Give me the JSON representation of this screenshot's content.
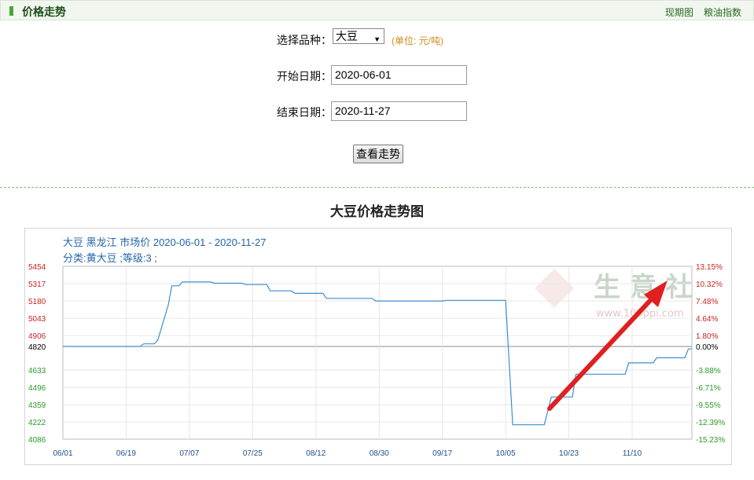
{
  "topbar": {
    "title": "价格走势",
    "links": [
      "现期图",
      "粮油指数"
    ]
  },
  "form": {
    "variety_label": "选择品种：",
    "variety_value": "大豆",
    "unit": "(单位: 元/吨)",
    "start_label": "开始日期：",
    "start_value": "2020-06-01",
    "end_label": "结束日期：",
    "end_value": "2020-11-27",
    "submit_label": "查看走势"
  },
  "chart_heading": "大豆价格走势图",
  "chart_subtitle_1": "大豆 黑龙江 市场价 2020-06-01 - 2020-11-27",
  "chart_subtitle_2": "分类:黄大豆 ;等级:3 ;",
  "watermark": "生 意 社",
  "watermark_url": "www.100ppi.com",
  "colors": {
    "line": "#3a8fd1",
    "up": "#cc2222",
    "down": "#2a9a2a",
    "arrow": "#e02020"
  },
  "chart_data": {
    "type": "line",
    "title": "大豆 黑龙江 市场价 2020-06-01 - 2020-11-27",
    "base_value": 4820,
    "ylim": [
      4086,
      5454
    ],
    "y_ticks_left": [
      5454,
      5317,
      5180,
      5043,
      4906,
      4820,
      4633,
      4496,
      4359,
      4222,
      4086
    ],
    "y_ticks_right": [
      "13.15%",
      "10.32%",
      "7.48%",
      "4.64%",
      "1.80%",
      "0.00%",
      "-3.88%",
      "-6.71%",
      "-9.55%",
      "-12.39%",
      "-15.23%"
    ],
    "x_ticks": [
      "06/01",
      "06/19",
      "07/07",
      "07/25",
      "08/12",
      "08/30",
      "09/17",
      "10/05",
      "10/23",
      "11/10"
    ],
    "x_start": "2020-06-01",
    "x_end": "2020-11-27",
    "grid": true,
    "series": [
      {
        "points": [
          [
            "2020-06-01",
            4820
          ],
          [
            "2020-06-23",
            4820
          ],
          [
            "2020-06-24",
            4840
          ],
          [
            "2020-06-27",
            4840
          ],
          [
            "2020-06-28",
            4870
          ],
          [
            "2020-07-01",
            5150
          ],
          [
            "2020-07-02",
            5300
          ],
          [
            "2020-07-04",
            5300
          ],
          [
            "2020-07-05",
            5330
          ],
          [
            "2020-07-13",
            5330
          ],
          [
            "2020-07-14",
            5320
          ],
          [
            "2020-07-22",
            5320
          ],
          [
            "2020-07-23",
            5310
          ],
          [
            "2020-07-29",
            5310
          ],
          [
            "2020-07-30",
            5260
          ],
          [
            "2020-08-05",
            5260
          ],
          [
            "2020-08-06",
            5240
          ],
          [
            "2020-08-14",
            5240
          ],
          [
            "2020-08-15",
            5200
          ],
          [
            "2020-08-28",
            5200
          ],
          [
            "2020-08-29",
            5180
          ],
          [
            "2020-09-17",
            5180
          ],
          [
            "2020-09-18",
            5185
          ],
          [
            "2020-10-05",
            5185
          ],
          [
            "2020-10-07",
            4200
          ],
          [
            "2020-10-16",
            4200
          ],
          [
            "2020-10-18",
            4420
          ],
          [
            "2020-10-24",
            4420
          ],
          [
            "2020-10-25",
            4600
          ],
          [
            "2020-11-08",
            4600
          ],
          [
            "2020-11-09",
            4690
          ],
          [
            "2020-11-16",
            4690
          ],
          [
            "2020-11-17",
            4730
          ],
          [
            "2020-11-25",
            4730
          ],
          [
            "2020-11-26",
            4800
          ],
          [
            "2020-11-27",
            4800
          ]
        ]
      }
    ],
    "annotation": "red arrow pointing up-right"
  }
}
